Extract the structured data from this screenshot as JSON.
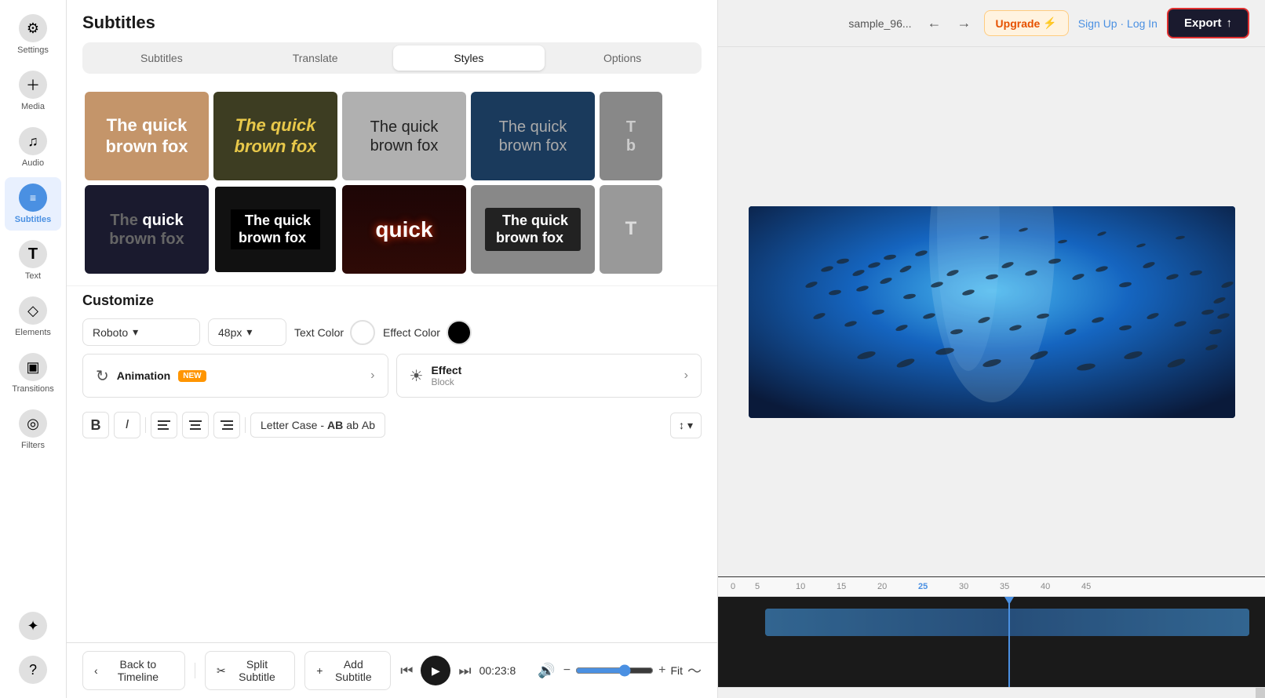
{
  "app": {
    "title": "Subtitles"
  },
  "sidebar": {
    "items": [
      {
        "id": "settings",
        "label": "Settings",
        "icon": "⚙"
      },
      {
        "id": "media",
        "label": "Media",
        "icon": "＋"
      },
      {
        "id": "audio",
        "label": "Audio",
        "icon": "♪"
      },
      {
        "id": "subtitles",
        "label": "Subtitles",
        "icon": "≡",
        "active": true
      },
      {
        "id": "text",
        "label": "Text",
        "icon": "T"
      },
      {
        "id": "elements",
        "label": "Elements",
        "icon": "◇"
      },
      {
        "id": "transitions",
        "label": "Transitions",
        "icon": "▣"
      },
      {
        "id": "filters",
        "label": "Filters",
        "icon": "◎"
      },
      {
        "id": "magic",
        "label": "",
        "icon": "✦"
      },
      {
        "id": "help",
        "label": "",
        "icon": "?"
      }
    ]
  },
  "tabs": {
    "items": [
      {
        "id": "subtitles",
        "label": "Subtitles"
      },
      {
        "id": "translate",
        "label": "Translate"
      },
      {
        "id": "styles",
        "label": "Styles",
        "active": true
      },
      {
        "id": "options",
        "label": "Options"
      }
    ]
  },
  "style_cards": [
    {
      "id": 1,
      "text": "The quick brown fox",
      "style": "card-1"
    },
    {
      "id": 2,
      "text": "The quick brown fox",
      "style": "card-2"
    },
    {
      "id": 3,
      "text": "The quick brown fox",
      "style": "card-3"
    },
    {
      "id": 4,
      "text": "The quick brown fox",
      "style": "card-4"
    },
    {
      "id": 5,
      "text": "T b",
      "style": "card-5"
    },
    {
      "id": 6,
      "text": "The quick brown fox",
      "style": "card-6"
    },
    {
      "id": 7,
      "text": "The quick brown fox",
      "style": "card-7"
    },
    {
      "id": 8,
      "text": "quick",
      "style": "card-8"
    },
    {
      "id": 9,
      "text": "The quick brown fox",
      "style": "card-9"
    },
    {
      "id": 10,
      "text": "T",
      "style": "card-10"
    }
  ],
  "customize": {
    "title": "Customize",
    "font": "Roboto",
    "font_arrow": "▾",
    "size": "48px",
    "size_arrow": "▾",
    "text_color_label": "Text Color",
    "text_color": "#ffffff",
    "effect_color_label": "Effect Color",
    "effect_color": "#000000"
  },
  "animation": {
    "label": "Animation",
    "badge": "NEW",
    "arrow": "›"
  },
  "effect": {
    "label": "Effect",
    "sublabel": "Block",
    "arrow": "›"
  },
  "formatting": {
    "bold": "B",
    "italic": "I",
    "align_left": "≡",
    "align_center": "≡",
    "align_right": "≡",
    "letter_case": "Letter Case",
    "dash": "-",
    "ab_upper": "AB",
    "ab_lower": "ab",
    "ab_title": "Ab",
    "line_spacing": "↕",
    "line_arrow": "▾"
  },
  "bottom_bar": {
    "back_label": "Back to Timeline",
    "split_label": "Split Subtitle",
    "add_label": "Add Subtitle",
    "time": "00:23:8"
  },
  "header": {
    "file_name": "sample_96...",
    "upgrade_label": "Upgrade",
    "upgrade_icon": "⚡",
    "sign_up": "Sign Up",
    "login": "Log In",
    "separator": "·",
    "export_label": "Export",
    "export_icon": "↑"
  },
  "timeline": {
    "volume_icon": "🔊",
    "zoom_min": "−",
    "zoom_max": "+",
    "fit_label": "Fit",
    "waveform_icon": "∿",
    "ruler_marks": [
      "0",
      "5",
      "10",
      "15",
      "20",
      "25",
      "30",
      "35",
      "40",
      "45"
    ]
  },
  "colors": {
    "accent_blue": "#4a90e2",
    "export_bg": "#1a1a2e",
    "export_border": "#e03030",
    "upgrade_bg": "#fff3e0",
    "active_tab_bg": "#ffffff"
  }
}
